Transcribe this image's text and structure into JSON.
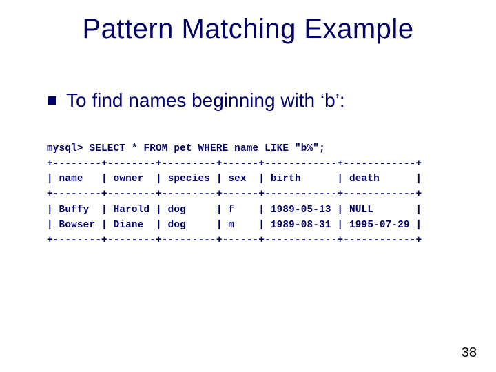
{
  "title": "Pattern Matching Example",
  "bullet": "To find names beginning with ‘b’:",
  "code": "mysql> SELECT * FROM pet WHERE name LIKE \"b%\";\n+--------+--------+---------+------+------------+------------+\n| name   | owner  | species | sex  | birth      | death      |\n+--------+--------+---------+------+------------+------------+\n| Buffy  | Harold | dog     | f    | 1989-05-13 | NULL       |\n| Bowser | Diane  | dog     | m    | 1989-08-31 | 1995-07-29 |\n+--------+--------+---------+------+------------+------------+",
  "pagenum": "38",
  "chart_data": {
    "type": "table",
    "query": "SELECT * FROM pet WHERE name LIKE \"b%\";",
    "columns": [
      "name",
      "owner",
      "species",
      "sex",
      "birth",
      "death"
    ],
    "rows": [
      {
        "name": "Buffy",
        "owner": "Harold",
        "species": "dog",
        "sex": "f",
        "birth": "1989-05-13",
        "death": "NULL"
      },
      {
        "name": "Bowser",
        "owner": "Diane",
        "species": "dog",
        "sex": "m",
        "birth": "1989-08-31",
        "death": "1995-07-29"
      }
    ]
  }
}
